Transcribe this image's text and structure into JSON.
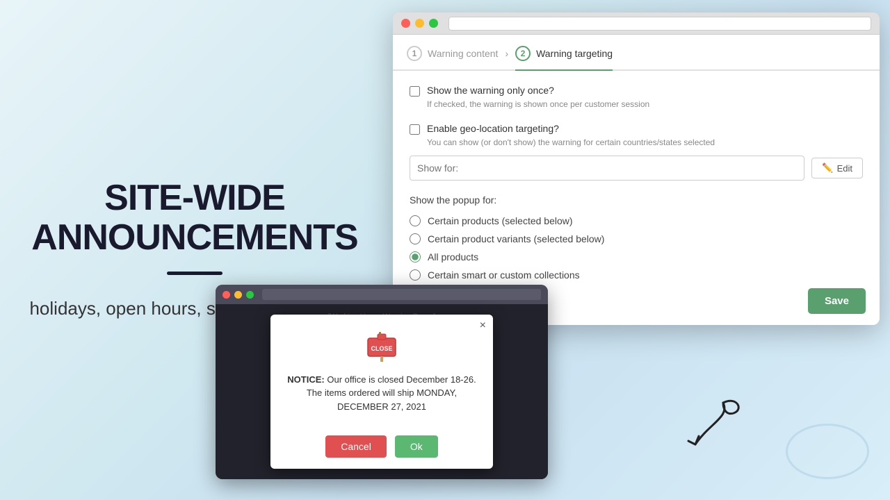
{
  "page": {
    "background": "gradient-blue"
  },
  "left_panel": {
    "title_line1": "SITE-WIDE",
    "title_line2": "ANNOUNCEMENTS",
    "subtitle": "holidays, open hours, shipping delay, etc."
  },
  "browser": {
    "step1_label": "Warning content",
    "step1_num": "1",
    "step2_label": "Warning targeting",
    "step2_num": "2",
    "show_once_label": "Show the warning only once?",
    "show_once_helper": "If checked, the warning is shown once per customer session",
    "geo_label": "Enable geo-location targeting?",
    "geo_helper": "You can show (or don't show) the warning for certain countries/states selected",
    "show_for_placeholder": "Show for:",
    "edit_label": "Edit",
    "show_popup_label": "Show the popup for:",
    "radio_options": [
      {
        "id": "opt1",
        "label": "Certain products (selected below)",
        "checked": false
      },
      {
        "id": "opt2",
        "label": "Certain product variants (selected below)",
        "checked": false
      },
      {
        "id": "opt3",
        "label": "All products",
        "checked": true
      },
      {
        "id": "opt4",
        "label": "Certain smart or custom collections",
        "checked": false
      }
    ],
    "save_label": "Save"
  },
  "demo_window": {
    "title_bar_text": "{Working Hours Warning Demo}"
  },
  "modal": {
    "close_symbol": "×",
    "notice_label": "NOTICE:",
    "notice_text": " Our office is closed December 18-26. The items ordered will ship MONDAY, DECEMBER 27, 2021",
    "cancel_label": "Cancel",
    "ok_label": "Ok"
  }
}
